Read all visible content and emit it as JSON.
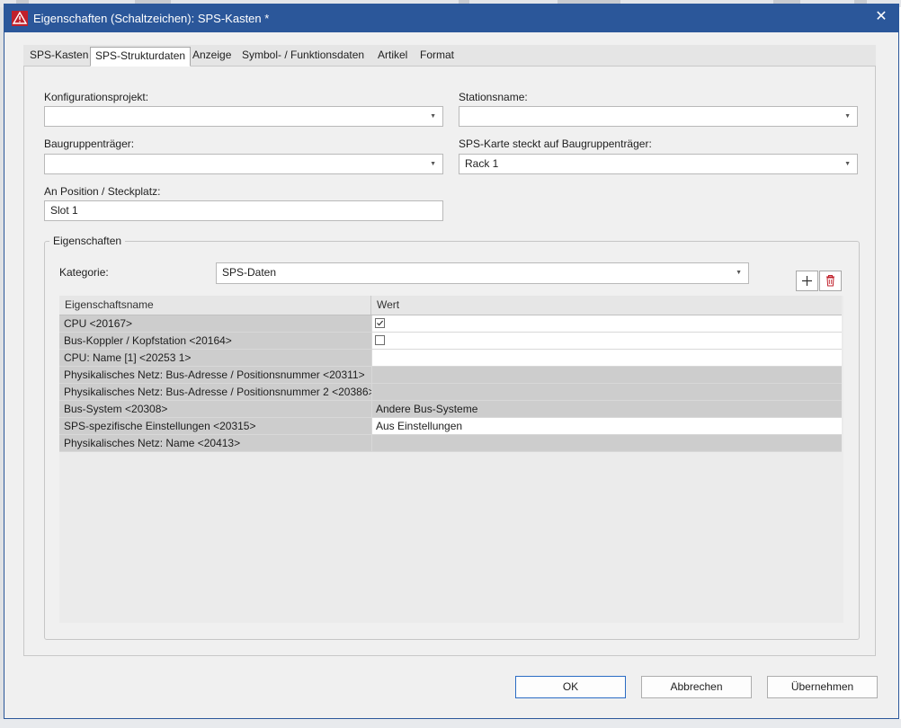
{
  "window": {
    "title": "Eigenschaften (Schaltzeichen): SPS-Kasten *",
    "close_glyph": "✕",
    "colors": {
      "titlebar": "#2b579a",
      "app_icon": "#c0202b"
    }
  },
  "tabs": [
    {
      "label": "SPS-Kasten",
      "active": false
    },
    {
      "label": "SPS-Strukturdaten",
      "active": true
    },
    {
      "label": "Anzeige",
      "active": false
    },
    {
      "label": "Symbol- / Funktionsdaten",
      "active": false
    },
    {
      "label": "Artikel",
      "active": false
    },
    {
      "label": "Format",
      "active": false
    }
  ],
  "form": {
    "konfigurationsprojekt": {
      "label": "Konfigurationsprojekt:",
      "value": ""
    },
    "stationsname": {
      "label": "Stationsname:",
      "value": ""
    },
    "baugruppentraeger": {
      "label": "Baugruppenträger:",
      "value": ""
    },
    "sps_karte": {
      "label": "SPS-Karte steckt auf Baugruppenträger:",
      "value": "Rack 1"
    },
    "position": {
      "label": "An Position / Steckplatz:",
      "value": "Slot 1"
    }
  },
  "properties": {
    "group_title": "Eigenschaften",
    "kategorie_label": "Kategorie:",
    "kategorie_value": "SPS-Daten",
    "add_icon": "plus-icon",
    "delete_icon": "trash-icon",
    "columns": [
      "Eigenschaftsname",
      "Wert"
    ],
    "rows": [
      {
        "name": "CPU <20167>",
        "value": "",
        "type": "checkbox",
        "checked": true,
        "bg": "white"
      },
      {
        "name": "Bus-Koppler / Kopfstation <20164>",
        "value": "",
        "type": "checkbox",
        "checked": false,
        "bg": "white"
      },
      {
        "name": "CPU: Name [1] <20253 1>",
        "value": "",
        "type": "text",
        "bg": "white"
      },
      {
        "name": "Physikalisches Netz: Bus-Adresse / Positionsnummer <20311>",
        "value": "",
        "type": "text",
        "bg": "gray"
      },
      {
        "name": "Physikalisches Netz: Bus-Adresse / Positionsnummer 2 <20386>",
        "value": "",
        "type": "text",
        "bg": "gray"
      },
      {
        "name": "Bus-System <20308>",
        "value": "Andere Bus-Systeme",
        "type": "text",
        "bg": "gray"
      },
      {
        "name": "SPS-spezifische Einstellungen <20315>",
        "value": "Aus Einstellungen",
        "type": "text",
        "bg": "white"
      },
      {
        "name": "Physikalisches Netz: Name <20413>",
        "value": "",
        "type": "text",
        "bg": "gray"
      }
    ]
  },
  "buttons": {
    "ok": "OK",
    "cancel": "Abbrechen",
    "apply": "Übernehmen"
  }
}
